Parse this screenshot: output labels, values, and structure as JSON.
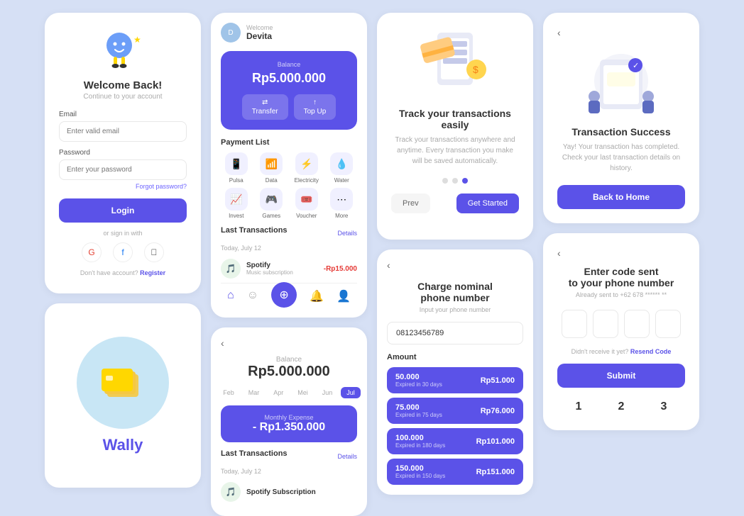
{
  "login": {
    "title": "Welcome Back!",
    "subtitle": "Continue to your account",
    "email_label": "Email",
    "email_placeholder": "Enter valid email",
    "password_label": "Password",
    "password_placeholder": "Enter your password",
    "forgot_text": "Forgot password?",
    "login_btn": "Login",
    "or_text": "or sign in with",
    "register_text": "Don't have account?",
    "register_link": "Register"
  },
  "wally": {
    "title": "Wally"
  },
  "dashboard": {
    "welcome": "Welcome",
    "user": "Devita",
    "balance_label": "Balance",
    "balance": "Rp5.000.000",
    "transfer_btn": "Transfer",
    "topup_btn": "Top Up",
    "payment_title": "Payment List",
    "payments": [
      {
        "icon": "📱",
        "label": "Pulsa"
      },
      {
        "icon": "📶",
        "label": "Data"
      },
      {
        "icon": "⚡",
        "label": "Electricity"
      },
      {
        "icon": "💧",
        "label": "Water"
      },
      {
        "icon": "📈",
        "label": "Invest"
      },
      {
        "icon": "🎮",
        "label": "Games"
      },
      {
        "icon": "🎟️",
        "label": "Voucher"
      },
      {
        "icon": "⋯",
        "label": "More"
      }
    ],
    "transactions_title": "Last Transactions",
    "details_link": "Details",
    "tx_date": "Today, July 12",
    "transactions": [
      {
        "name": "Spotify",
        "sub": "Music subscription",
        "amount": "-Rp15.000",
        "color": "#4caf50"
      }
    ]
  },
  "balance_detail": {
    "back": "‹",
    "balance_label": "Balance",
    "balance": "Rp5.000.000",
    "months": [
      "Feb",
      "Mar",
      "Apr",
      "Mei",
      "Jun",
      "Jul"
    ],
    "active_month": "Jul",
    "expense_label": "Monthly Expense",
    "expense_arrow": "↓",
    "expense_amount": "- Rp1.350.000",
    "transactions_title": "Last Transactions",
    "details_link": "Details",
    "tx_date": "Today, July 12",
    "transactions": [
      {
        "name": "Spotify Subscription",
        "sub": "",
        "amount": "",
        "color": "#4caf50"
      }
    ]
  },
  "track": {
    "title": "Track your transactions easily",
    "description": "Track your transactions anywhere and anytime. Every transaction you make will be saved automatically.",
    "dots": [
      false,
      false,
      true
    ],
    "prev_btn": "Prev",
    "next_btn": "Get Started"
  },
  "charge": {
    "back": "‹",
    "title": "Charge nominal phone number",
    "subtitle": "Input your phone number",
    "phone_value": "08123456789",
    "amount_label": "Amount",
    "options": [
      {
        "value": "50.000",
        "expire": "Expired in 30 days",
        "price": "Rp51.000"
      },
      {
        "value": "75.000",
        "expire": "Expired in 75 days",
        "price": "Rp76.000"
      },
      {
        "value": "100.000",
        "expire": "Expired in 180 days",
        "price": "Rp101.000"
      },
      {
        "value": "150.000",
        "expire": "Expired in 150 days",
        "price": "Rp151.000"
      }
    ]
  },
  "success": {
    "back": "‹",
    "title": "Transaction Success",
    "description": "Yay! Your transaction has completed. Check your last transaction details on history.",
    "home_btn": "Back to Home"
  },
  "code": {
    "back": "‹",
    "title": "Enter code sent to your phone number",
    "subtitle": "Already sent to +62 678 ****** **",
    "boxes": [
      "",
      "",
      "",
      ""
    ],
    "resend_text": "Didn't receive it yet?",
    "resend_link": "Resend Code",
    "submit_btn": "Submit",
    "numpad": [
      "1",
      "2",
      "3"
    ]
  }
}
